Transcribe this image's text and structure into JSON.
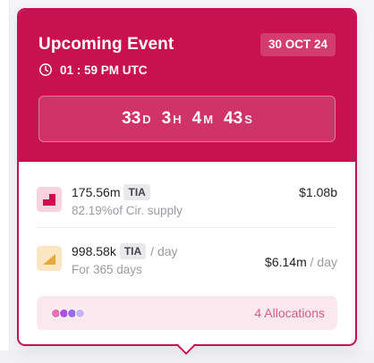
{
  "event": {
    "title": "Upcoming Event",
    "date": "30 OCT 24",
    "time": "01 : 59 PM UTC"
  },
  "countdown": [
    {
      "num": "33",
      "unit": "D"
    },
    {
      "num": "3",
      "unit": "H"
    },
    {
      "num": "4",
      "unit": "M"
    },
    {
      "num": "43",
      "unit": "S"
    }
  ],
  "unlock": {
    "amount": "175.56m",
    "token": "TIA",
    "note": "82.19%of Cir. supply",
    "value": "$1.08b",
    "icon": "step-chart-icon"
  },
  "emission": {
    "amount": "998.58k",
    "token": "TIA",
    "per": "/ day",
    "note": "For 365 days",
    "value": "$6.14m",
    "value_per": "/ day",
    "icon": "linear-ramp-icon"
  },
  "allocations": {
    "label": "4 Allocations",
    "dot_colors": [
      "#e86fb3",
      "#b04fe0",
      "#9a6ae8",
      "#c9b3f4"
    ]
  },
  "colors": {
    "accent": "#c8124f",
    "alloc_bg": "#fbe8ef",
    "alloc_text": "#d06084"
  }
}
